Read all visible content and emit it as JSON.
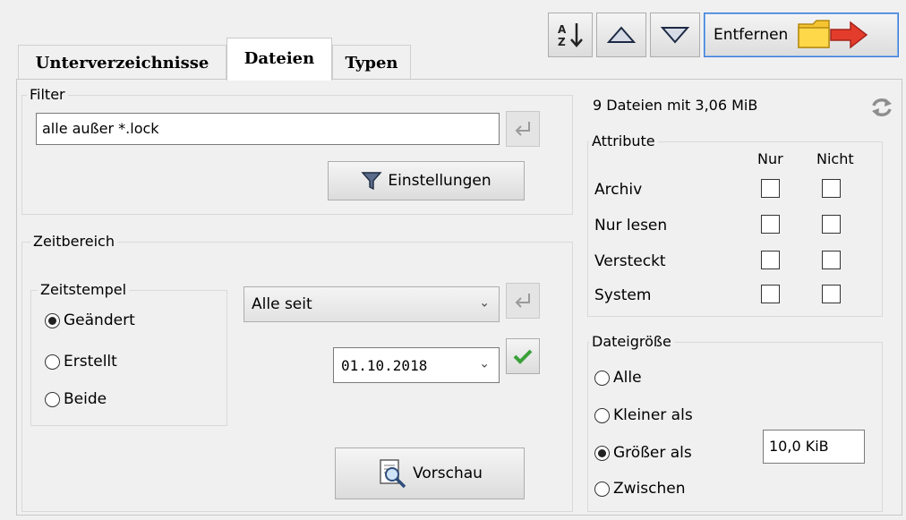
{
  "tabs": [
    "Unterverzeichnisse",
    "Dateien",
    "Typen"
  ],
  "toolbar": {
    "remove_label": "Entfernen"
  },
  "filter": {
    "legend": "Filter",
    "value": "alle außer *.lock",
    "settings_label": "Einstellungen"
  },
  "zeitbereich": {
    "legend": "Zeitbereich",
    "zeitstempel_legend": "Zeitstempel",
    "radios": [
      "Geändert",
      "Erstellt",
      "Beide"
    ],
    "selected": "Geändert",
    "mode_value": "Alle seit",
    "date_value": "01.10.2018",
    "preview_label": "Vorschau"
  },
  "summary": "9 Dateien mit 3,06 MiB",
  "attribute": {
    "legend": "Attribute",
    "col_only": "Nur",
    "col_not": "Nicht",
    "rows": [
      "Archiv",
      "Nur lesen",
      "Versteckt",
      "System"
    ]
  },
  "size": {
    "legend": "Dateigröße",
    "radios": [
      "Alle",
      "Kleiner als",
      "Größer als",
      "Zwischen"
    ],
    "selected": "Größer als",
    "value": "10,0 KiB"
  },
  "colors": {
    "accent_border": "#3a7bd5",
    "folder": "#f5c431",
    "arrow": "#e43c2c",
    "check": "#3aa13a"
  }
}
